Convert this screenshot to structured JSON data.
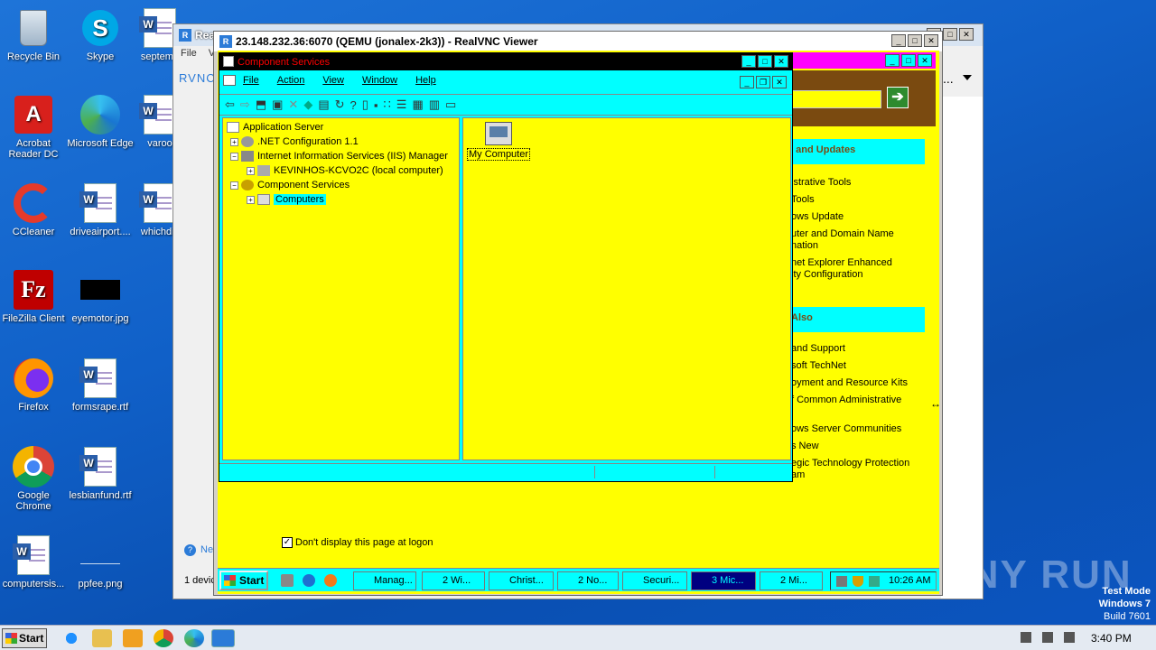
{
  "desktop": {
    "icons": [
      {
        "label": "Recycle Bin",
        "icon": "recycle-bin-icon"
      },
      {
        "label": "Skype",
        "icon": "skype-icon"
      },
      {
        "label": "septemb",
        "icon": "word-doc-icon"
      },
      {
        "label": "Acrobat Reader DC",
        "icon": "acrobat-icon"
      },
      {
        "label": "Microsoft Edge",
        "icon": "edge-icon"
      },
      {
        "label": "varoo",
        "icon": "word-doc-icon"
      },
      {
        "label": "CCleaner",
        "icon": "ccleaner-icon"
      },
      {
        "label": "driveairport....",
        "icon": "word-doc-icon"
      },
      {
        "label": "whichdis",
        "icon": "word-doc-icon"
      },
      {
        "label": "FileZilla Client",
        "icon": "filezilla-icon"
      },
      {
        "label": "eyemotor.jpg",
        "icon": "image-file-icon"
      },
      {
        "label": "Firefox",
        "icon": "firefox-icon"
      },
      {
        "label": "formsrape.rtf",
        "icon": "word-doc-icon"
      },
      {
        "label": "Google Chrome",
        "icon": "chrome-icon"
      },
      {
        "label": "lesbianfund.rtf",
        "icon": "word-doc-icon"
      },
      {
        "label": "computersis...",
        "icon": "word-doc-icon"
      },
      {
        "label": "ppfee.png",
        "icon": "image-file-icon"
      }
    ],
    "watermark": "ANY RUN",
    "test_mode": [
      "Test Mode",
      "Windows 7",
      "Build 7601"
    ]
  },
  "vnc_back": {
    "title": "Rea",
    "menu": [
      "File",
      "Vi"
    ],
    "logo": "RVNC",
    "bottom_text": "1 devic",
    "link": "Ne"
  },
  "vnc": {
    "title": "23.148.232.36:6070 (QEMU (jonalex-2k3)) - RealVNC Viewer"
  },
  "mgmt": {
    "ellipsis": "...",
    "section1": "s and Updates",
    "links1": [
      "istrative Tools",
      "Tools",
      "ows Update",
      "uter and Domain Name",
      "nation",
      "net Explorer Enhanced",
      "ity Configuration"
    ],
    "section2": "Also",
    "links2": [
      "and Support",
      "soft TechNet",
      "oyment and Resource Kits",
      "f Common Administrative",
      "ows Server Communities",
      "s New",
      "egic Technology Protection",
      "am"
    ],
    "checkbox_label": "Don't display this page at logon"
  },
  "mmc": {
    "title": "Component Services",
    "menu": [
      "File",
      "Action",
      "View",
      "Window",
      "Help"
    ],
    "tree": {
      "root": "Application Server",
      "n1": ".NET Configuration 1.1",
      "n2": "Internet Information Services (IIS) Manager",
      "n3": "KEVINHOS-KCVO2C (local computer)",
      "n4": "Component Services",
      "n5": "Computers"
    },
    "right_item": "My Computer"
  },
  "remote_taskbar": {
    "start": "Start",
    "items": [
      "Manag...",
      "2 Wi...",
      "Christ...",
      "2 No...",
      "Securi...",
      "3 Mic...",
      "2 Mi..."
    ],
    "clock": "10:26 AM"
  },
  "taskbar": {
    "start": "Start",
    "clock": "3:40 PM"
  }
}
